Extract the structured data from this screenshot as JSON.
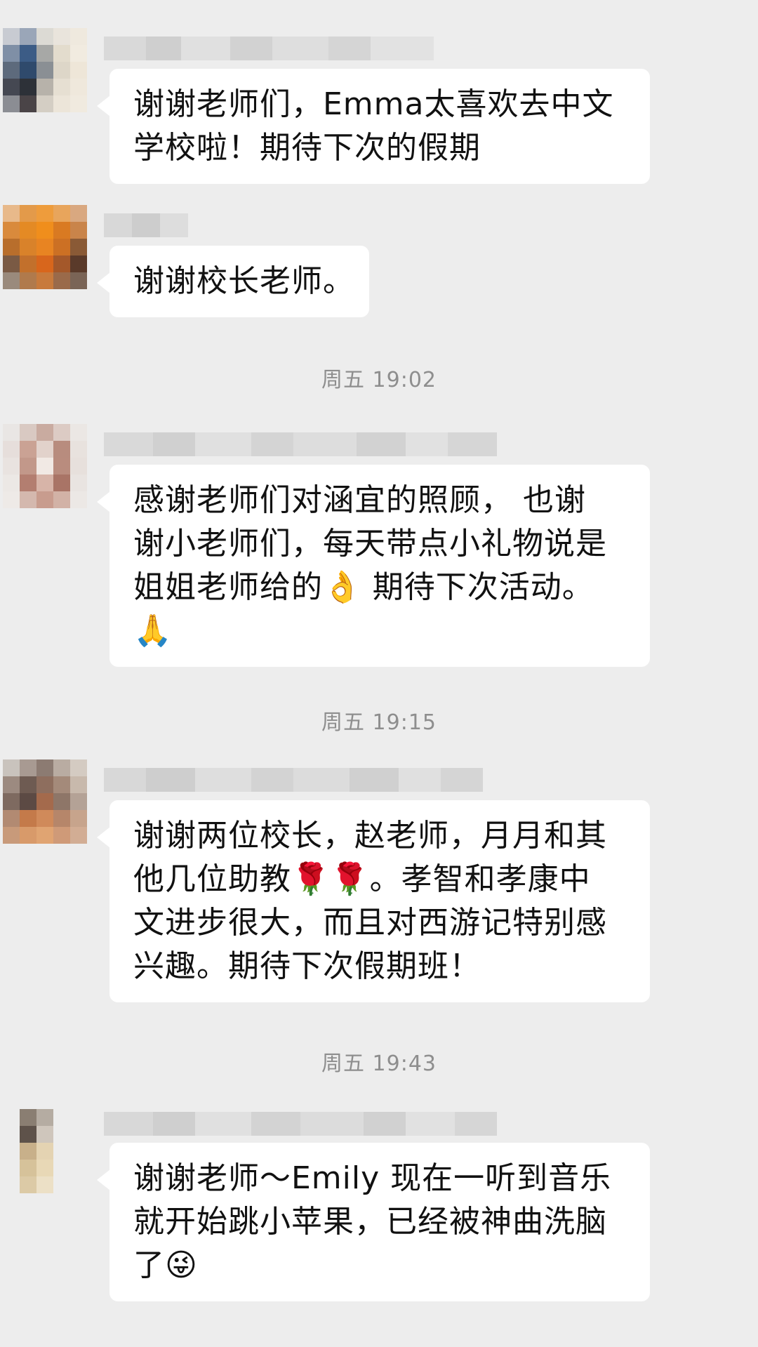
{
  "messages": [
    {
      "lines": [
        "谢谢老师们，Emma太喜欢去中文",
        "学校啦！期待下次的假期"
      ]
    },
    {
      "lines": [
        "谢谢校长老师。"
      ]
    },
    {
      "lines": [
        "感谢老师们对涵宜的照顾， 也谢",
        "谢小老师们，每天带点小礼物说是",
        "姐姐老师给的👌 期待下次活动。",
        "🙏"
      ]
    },
    {
      "lines": [
        "谢谢两位校长，赵老师，月月和其",
        "他几位助教🌹🌹。孝智和孝康中",
        "文进步很大，而且对西游记特别感",
        "兴趣。期待下次假期班！"
      ]
    },
    {
      "lines": [
        "谢谢老师～Emily 现在一听到音乐",
        "就开始跳小苹果，已经被神曲洗脑",
        "了😜"
      ]
    }
  ],
  "timestamps": [
    "周五 19:02",
    "周五 19:15",
    "周五 19:43"
  ],
  "colors": {
    "background": "#ededed",
    "bubble": "#ffffff",
    "timestamp_text": "#8e8e8e"
  }
}
